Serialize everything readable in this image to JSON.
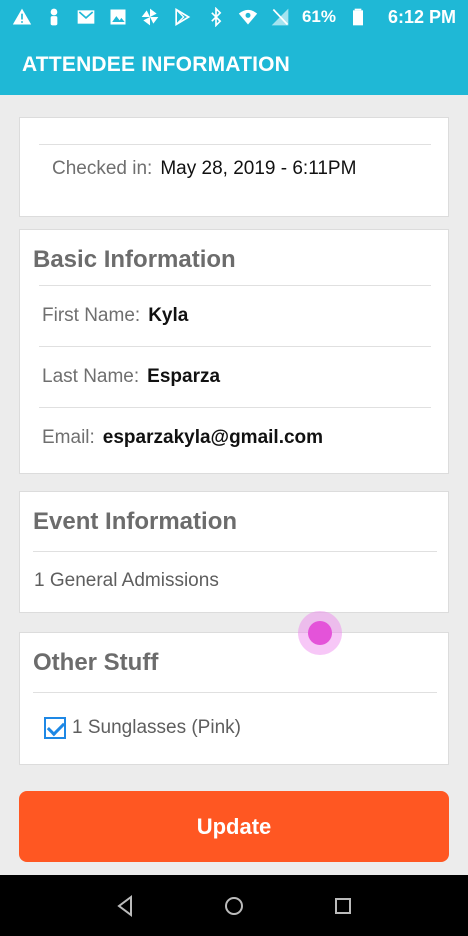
{
  "status_bar": {
    "battery_percent": "61%",
    "time": "6:12 PM"
  },
  "app_bar": {
    "title": "ATTENDEE INFORMATION"
  },
  "checkin": {
    "label": "Checked in:",
    "value": "May 28, 2019 - 6:11PM"
  },
  "basic_info": {
    "title": "Basic Information",
    "fields": [
      {
        "label": "First Name:",
        "value": "Kyla"
      },
      {
        "label": "Last Name:",
        "value": "Esparza"
      },
      {
        "label": "Email:",
        "value": "esparzakyla@gmail.com"
      }
    ]
  },
  "event_info": {
    "title": "Event Information",
    "item": "1 General Admissions"
  },
  "other_stuff": {
    "title": "Other Stuff",
    "item_label": "1 Sunglasses (Pink)",
    "item_checked": true
  },
  "update_button": {
    "label": "Update"
  },
  "colors": {
    "primary": "#1fb8d6",
    "button": "#ff5722",
    "checkbox": "#1e88e5"
  },
  "icons": [
    "warning-icon",
    "person-icon",
    "gmail-icon",
    "image-icon",
    "pinwheel-icon",
    "play-store-icon",
    "bluetooth-icon",
    "wifi-icon",
    "signal-icon",
    "battery-icon",
    "back-icon",
    "home-icon",
    "recents-icon"
  ]
}
